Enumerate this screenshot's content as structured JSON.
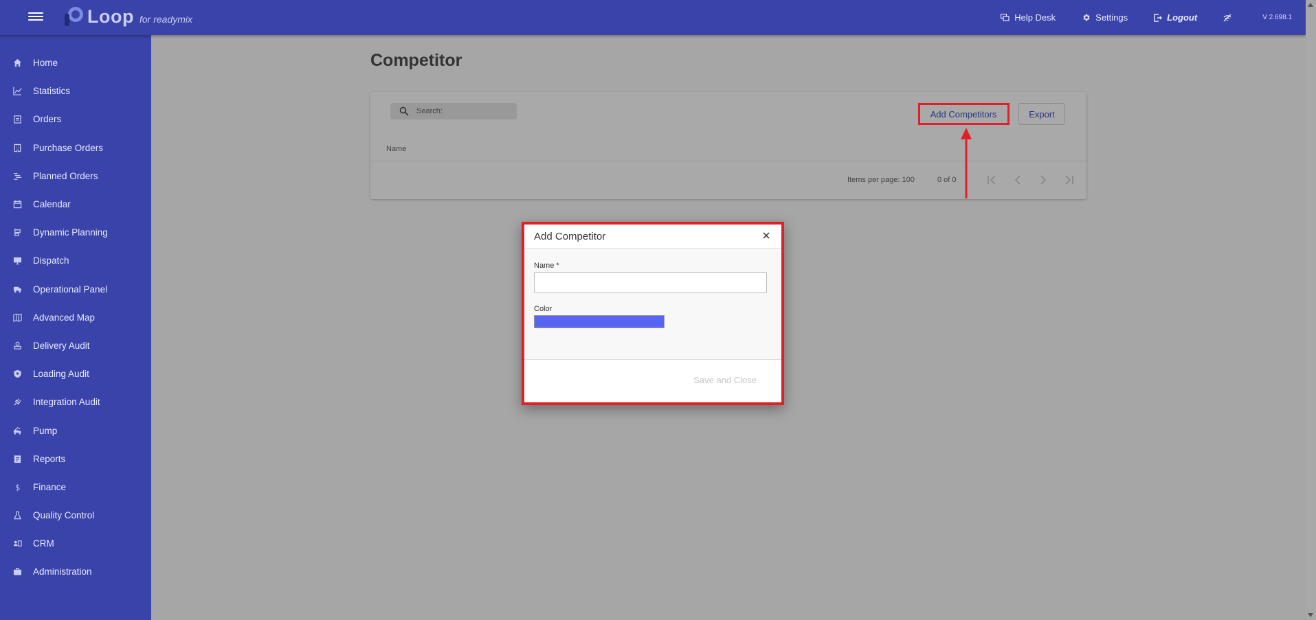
{
  "brand": {
    "name": "Loop",
    "subtitle": "for readymix"
  },
  "topbar": {
    "help_desk": "Help Desk",
    "settings": "Settings",
    "logout": "Logout",
    "version": "V 2.698.1"
  },
  "sidebar": {
    "items": [
      {
        "label": "Home",
        "icon": "home-icon"
      },
      {
        "label": "Statistics",
        "icon": "chart-line-icon"
      },
      {
        "label": "Orders",
        "icon": "clipboard-icon"
      },
      {
        "label": "Purchase Orders",
        "icon": "building-icon"
      },
      {
        "label": "Planned Orders",
        "icon": "planned-icon"
      },
      {
        "label": "Calendar",
        "icon": "calendar-icon"
      },
      {
        "label": "Dynamic Planning",
        "icon": "planning-icon"
      },
      {
        "label": "Dispatch",
        "icon": "monitor-icon"
      },
      {
        "label": "Operational Panel",
        "icon": "truck-icon"
      },
      {
        "label": "Advanced Map",
        "icon": "map-icon"
      },
      {
        "label": "Delivery Audit",
        "icon": "delivery-icon"
      },
      {
        "label": "Loading Audit",
        "icon": "shield-icon"
      },
      {
        "label": "Integration Audit",
        "icon": "plug-icon"
      },
      {
        "label": "Pump",
        "icon": "pump-icon"
      },
      {
        "label": "Reports",
        "icon": "report-icon"
      },
      {
        "label": "Finance",
        "icon": "dollar-icon"
      },
      {
        "label": "Quality Control",
        "icon": "flask-icon"
      },
      {
        "label": "CRM",
        "icon": "contacts-icon"
      },
      {
        "label": "Administration",
        "icon": "briefcase-icon"
      }
    ]
  },
  "main": {
    "title": "Competitor",
    "search_label": "Search:",
    "add_button": "Add Competitors",
    "export_button": "Export",
    "column_name": "Name",
    "items_per_page": "Items per page: 100",
    "range": "0 of 0"
  },
  "dialog": {
    "title": "Add Competitor",
    "name_label": "Name *",
    "name_value": "",
    "color_label": "Color",
    "color_value": "#5865f2",
    "save_button": "Save and Close"
  },
  "colors": {
    "primary": "#3a43a9",
    "highlight": "#e01f26"
  }
}
